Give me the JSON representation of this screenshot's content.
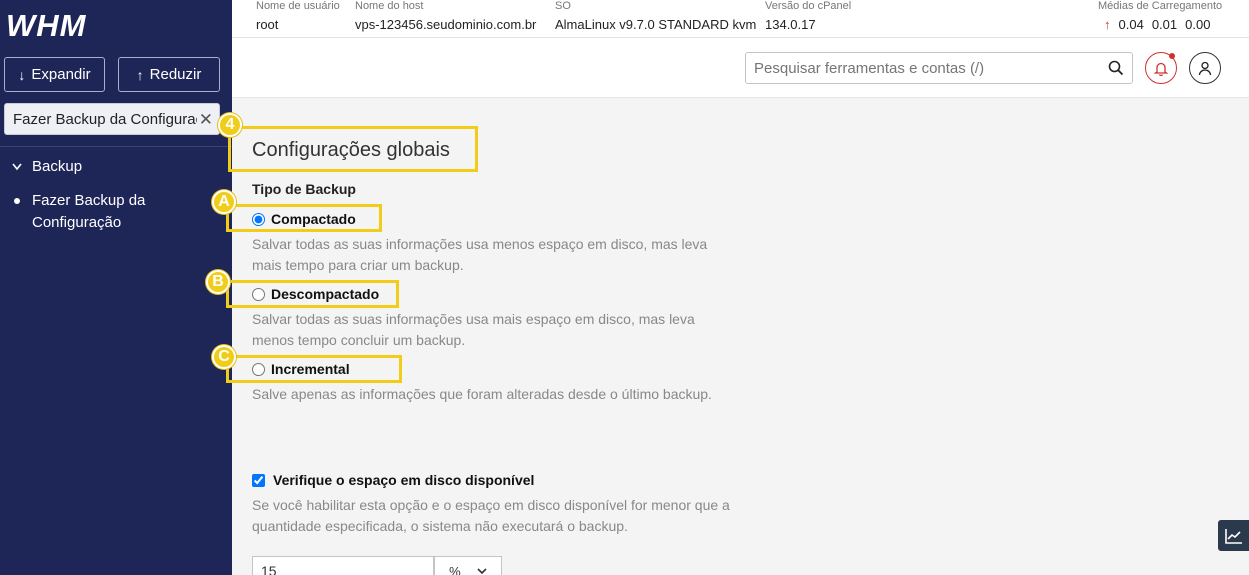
{
  "app": {
    "logo_text": "WHM"
  },
  "sidebar": {
    "expand_label": "Expandir",
    "reduce_label": "Reduzir",
    "search_value": "Fazer Backup da Configuraç",
    "group_label": "Backup",
    "item_label": "Fazer Backup da Configuração"
  },
  "infobar": {
    "username_label": "Nome de usuário",
    "username": "root",
    "hostname_label": "Nome do host",
    "hostname": "vps-123456.seudominio.com.br",
    "os_label": "SO",
    "os": "AlmaLinux v9.7.0 STANDARD kvm",
    "cpanel_label": "Versão do cPanel",
    "cpanel_version": "134.0.17",
    "load_label": "Médias de Carregamento",
    "load": [
      "0.04",
      "0.01",
      "0.00"
    ]
  },
  "header": {
    "search_placeholder": "Pesquisar ferramentas e contas (/)"
  },
  "main": {
    "section_title": "Configurações globais",
    "backup_type_label": "Tipo de Backup",
    "options": [
      {
        "label": "Compactado",
        "checked": true,
        "desc": "Salvar todas as suas informações usa menos espaço em disco, mas leva mais tempo para criar um backup."
      },
      {
        "label": "Descompactado",
        "checked": false,
        "desc": "Salvar todas as suas informações usa mais espaço em disco, mas leva menos tempo concluir um backup."
      },
      {
        "label": "Incremental",
        "checked": false,
        "desc": "Salve apenas as informações que foram alteradas desde o último backup."
      }
    ],
    "disk_check_label": "Verifique o espaço em disco disponível",
    "disk_check_desc": "Se você habilitar esta opção e o espaço em disco disponível for menor que a quantidade especificada, o sistema não executará o backup.",
    "disk_value": "15",
    "disk_unit": "%"
  },
  "annotations": {
    "marker_4": "4",
    "marker_a": "A",
    "marker_b": "B",
    "marker_c": "C"
  },
  "colors": {
    "sidebar_bg": "#1e2557",
    "highlight": "#f1cd1a",
    "alert_red": "#d0312d"
  }
}
